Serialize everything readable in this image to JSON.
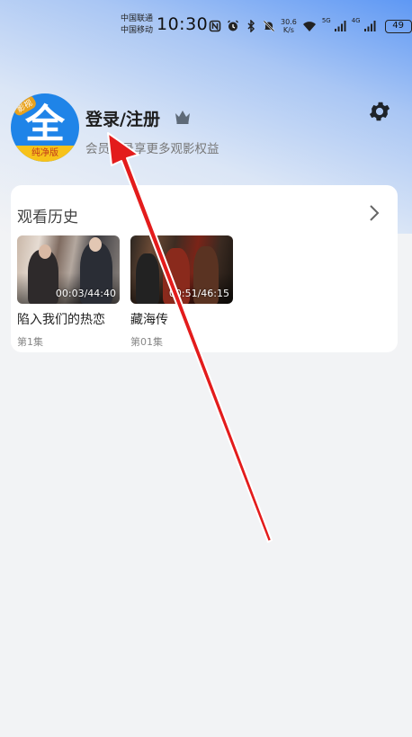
{
  "status_bar": {
    "carrier_1": "中国联通",
    "carrier_2": "中国移动",
    "time": "10:30",
    "net_speed_value": "30.6",
    "net_speed_unit": "K/s",
    "signal_1_label": "5G",
    "signal_2_label": "4G",
    "battery": "49",
    "icons": [
      "nfc-icon",
      "alarm-icon",
      "bluetooth-icon",
      "mute-icon",
      "wifi-icon",
      "signal-icon",
      "signal-icon",
      "battery-icon"
    ]
  },
  "profile": {
    "avatar_main": "全",
    "avatar_tag": "影视",
    "avatar_bottom": "纯净版",
    "login_title": "登录/注册",
    "login_subtitle": "会员登录享更多观影权益"
  },
  "history": {
    "title": "观看历史",
    "items": [
      {
        "title": "陷入我们的热恋",
        "progress": "00:03/44:40",
        "episode": "第1集"
      },
      {
        "title": "藏海传",
        "progress": "00:51/46:15",
        "episode": "第01集"
      }
    ]
  },
  "colors": {
    "accent_blue": "#1f84e8",
    "annotation_red": "#e31c1c"
  }
}
